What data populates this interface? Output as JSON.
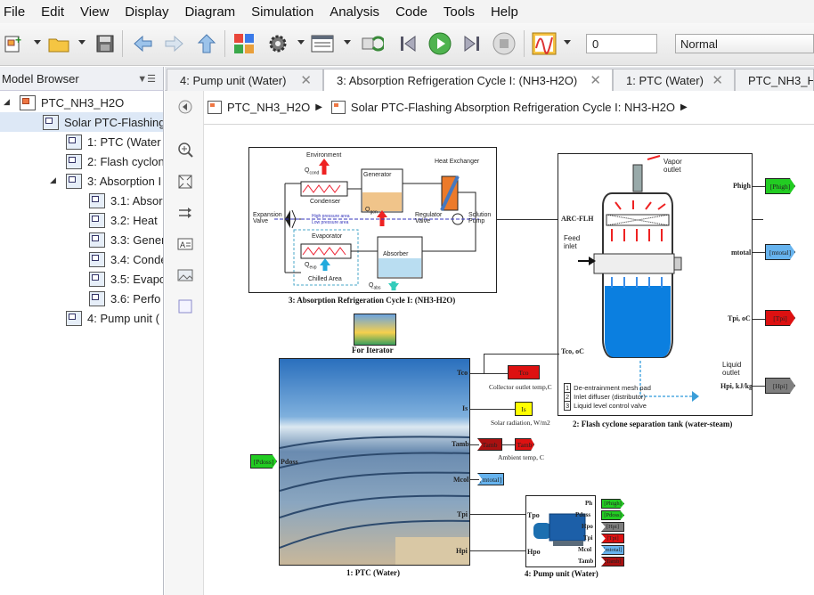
{
  "menu": [
    "File",
    "Edit",
    "View",
    "Display",
    "Diagram",
    "Simulation",
    "Analysis",
    "Code",
    "Tools",
    "Help"
  ],
  "toolbar": {
    "sim_time_value": "0",
    "mode_value": "Normal"
  },
  "model_browser": {
    "title": "Model Browser",
    "items": [
      {
        "label": "PTC_NH3_H2O"
      },
      {
        "label": "Solar PTC-Flashing"
      },
      {
        "label": "1: PTC (Water"
      },
      {
        "label": "2: Flash cyclon"
      },
      {
        "label": "3: Absorption I"
      },
      {
        "label": "3.1: Absor"
      },
      {
        "label": "3.2: Heat"
      },
      {
        "label": "3.3: Gener"
      },
      {
        "label": "3.4: Conde"
      },
      {
        "label": "3.5: Evapo"
      },
      {
        "label": "3.6: Perfo"
      },
      {
        "label": "4: Pump unit ("
      }
    ]
  },
  "tabs": [
    {
      "label": "4: Pump unit (Water)"
    },
    {
      "label": "3: Absorption Refrigeration Cycle I: (NH3-H2O)"
    },
    {
      "label": "1: PTC (Water)"
    },
    {
      "label": "PTC_NH3_H2"
    }
  ],
  "breadcrumb": {
    "root": "PTC_NH3_H2O",
    "child": "Solar PTC-Flashing Absorption Refrigeration Cycle I: NH3-H2O"
  },
  "diagram": {
    "absorption": {
      "caption": "3: Absorption Refrigeration Cycle I: (NH3-H2O)",
      "environment": "Environment",
      "qcond": "Q",
      "qcond_sub": "cond",
      "condenser": "Condenser",
      "generator": "Generator",
      "qgen": "Q",
      "qgen_sub": "gen",
      "heat_exchanger": "Heat Exchanger",
      "expansion_valve": "Expansion\nValve",
      "regulator_valve": "Regulator\nValve",
      "solution_pump": "Solution\nPump",
      "high_pressure": "High pressure area",
      "low_pressure": "Low pressure area",
      "evaporator": "Evaporator",
      "absorber": "Absorber",
      "qevp": "Q",
      "qevp_sub": "evp",
      "chilled_area": "Chilled Area",
      "qabs": "Q",
      "qabs_sub": "abs"
    },
    "iterator": {
      "caption": "For Iterator"
    },
    "flash": {
      "caption": "2: Flash cyclone separation tank (water-steam)",
      "vapor_outlet": "Vapor\noutlet",
      "feed_inlet": "Feed\ninlet",
      "liquid_outlet": "Liquid\noutlet",
      "legend": [
        "De-entrainment mesh pad",
        "Inlet diffuser (distributor)",
        "Liquid level control valve"
      ],
      "legend_nums": [
        "1",
        "2",
        "3"
      ],
      "port_in1": "ARC-FLH",
      "port_in2": "Tco, oC",
      "port_out": [
        "Phigh",
        "mtotal",
        "Tpi, oC",
        "Hpi, kJ/kg"
      ],
      "tags_out": [
        "[Phigh]",
        "[mtotal]",
        "[Tpi]",
        "[Hpi]"
      ]
    },
    "ptc": {
      "caption": "1: PTC (Water)",
      "ports_out": [
        "Tco",
        "Is",
        "Tamb",
        "Mcol",
        "Tpi",
        "Hpi"
      ],
      "port_in": "Pdoss",
      "tag_in": "[Pdoss]",
      "tag_tco": "Tco",
      "tag_is": "Is",
      "tag_tamb_left": "Tamb",
      "tag_tamb_right": "Tamb",
      "tag_mtotal": "[mtotal]",
      "label_tco": "Collector outlet temp,C",
      "label_is": "Solar radiation, W/m2",
      "label_tamb": "Ambient temp, C"
    },
    "pump": {
      "caption": "4: Pump unit (Water)",
      "ports_in": [
        "Tpo",
        "Hpo"
      ],
      "ports_out": [
        "Ph",
        "Pdoss",
        "Hpo",
        "Tpi",
        "Mcol",
        "Tamb"
      ],
      "tags": [
        "[Phigh]",
        "[Pdoss]",
        "[Hpi]",
        "[Tpi]",
        "[mtotal]",
        "[Tamb]"
      ]
    }
  },
  "colors": {
    "green": "#22cc22",
    "red": "#dd1111",
    "gray": "#7f7f7f",
    "blue": "#66b3ee",
    "yellow": "#ffff00",
    "darkred": "#aa1111"
  }
}
